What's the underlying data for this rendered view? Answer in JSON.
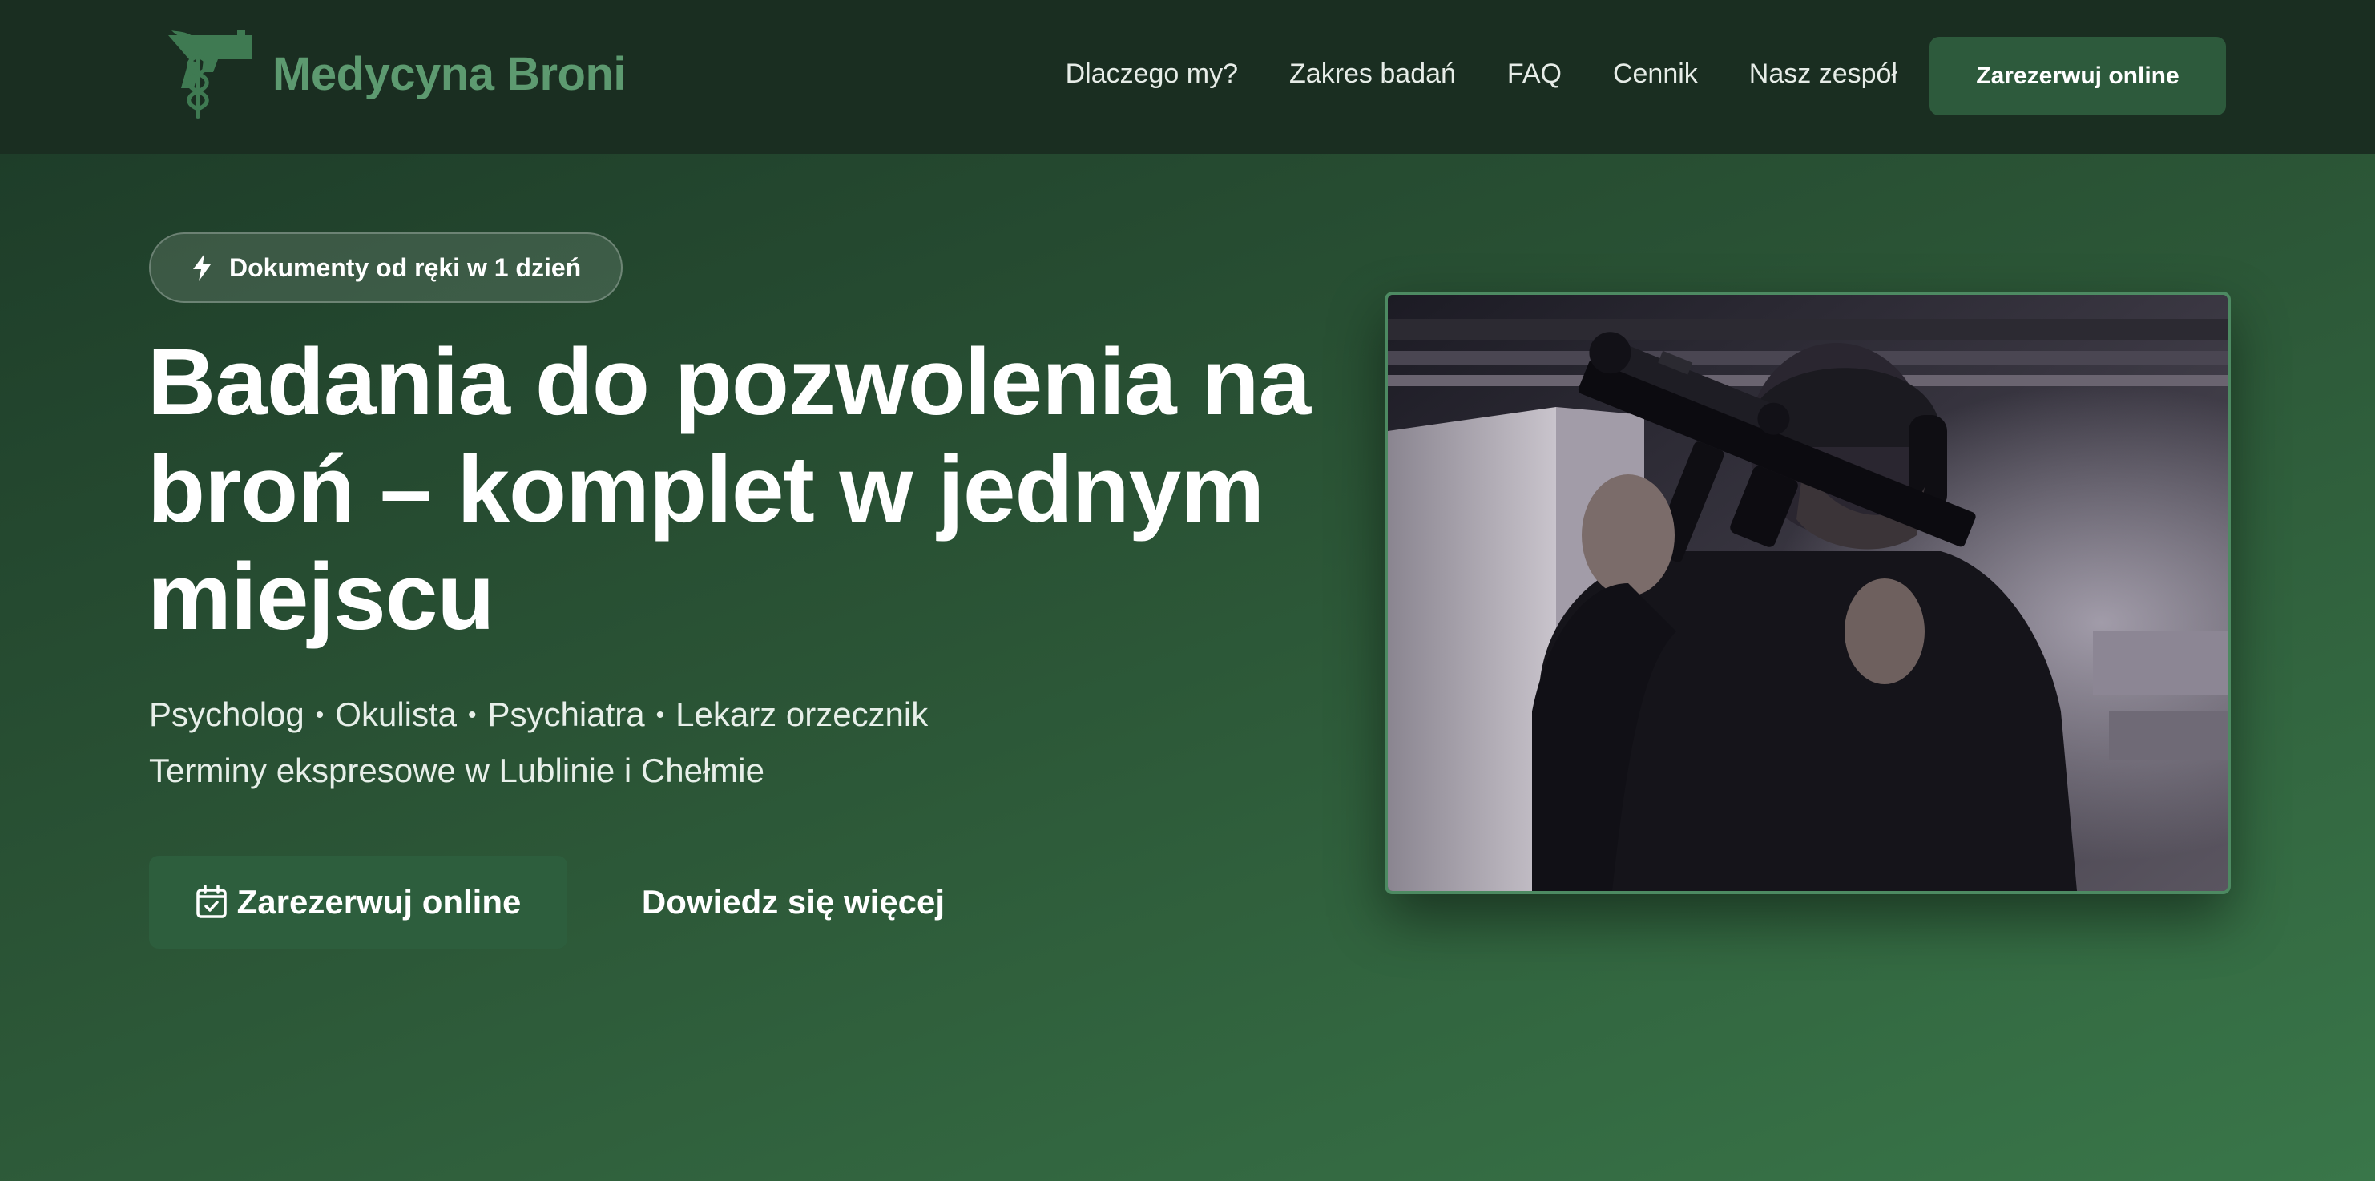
{
  "brand": {
    "name": "Medycyna Broni",
    "logo_icon": "caduceus-pistol-icon",
    "color": "#5d9a70"
  },
  "nav": {
    "items": [
      {
        "label": "Dlaczego my?"
      },
      {
        "label": "Zakres badań"
      },
      {
        "label": "FAQ"
      },
      {
        "label": "Cennik"
      },
      {
        "label": "Nasz zespół"
      }
    ],
    "cta_label": "Zarezerwuj online"
  },
  "hero": {
    "badge": {
      "icon": "lightning-bolt-icon",
      "text": "Dokumenty od ręki w 1 dzień"
    },
    "title": "Badania do pozwolenia na broń – komplet w jednym miejscu",
    "specialists": [
      "Psycholog",
      "Okulista",
      "Psychiatra",
      "Lekarz orzecznik"
    ],
    "separator": "•",
    "subtitle": "Terminy ekspresowe w Lublinie i Chełmie",
    "primary_button": {
      "icon": "calendar-check-icon",
      "label": "Zarezerwuj online"
    },
    "secondary_button": {
      "label": "Dowiedz się więcej"
    },
    "image": {
      "subject": "shooter-with-rifle-photo"
    }
  },
  "colors": {
    "header_bg": "#1a2e21",
    "accent": "#2d5a3c",
    "hero_gradient_start": "#1e3d29",
    "hero_gradient_end": "#397649",
    "text": "#ffffff"
  }
}
